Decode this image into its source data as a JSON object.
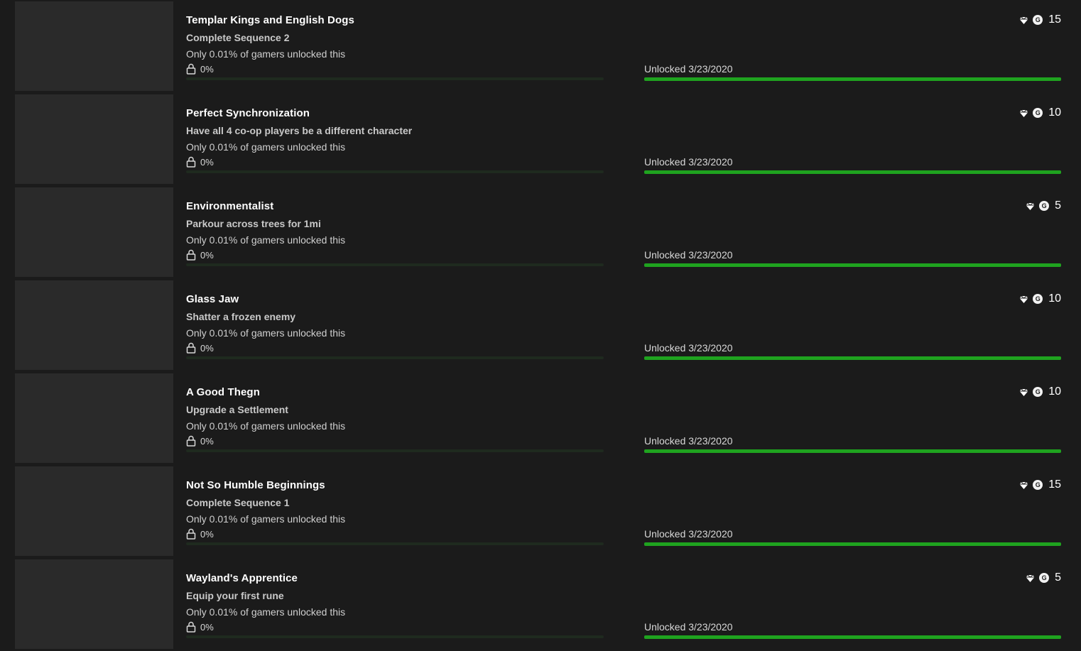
{
  "colors": {
    "background": "#1b1b1b",
    "progress_green": "#1fa31f",
    "thumbnail": "#2a2a2a"
  },
  "achievements": [
    {
      "title": "Templar Kings and English Dogs",
      "description": "Complete Sequence 2",
      "rarity": "Only 0.01% of gamers unlocked this",
      "progress_label": "0%",
      "unlocked": "Unlocked 3/23/2020",
      "score": "15",
      "unlock_progress": 1.0
    },
    {
      "title": "Perfect Synchronization",
      "description": "Have all 4 co-op players be a different character",
      "rarity": "Only 0.01% of gamers unlocked this",
      "progress_label": "0%",
      "unlocked": "Unlocked 3/23/2020",
      "score": "10",
      "unlock_progress": 1.0
    },
    {
      "title": "Environmentalist",
      "description": "Parkour across trees for 1mi",
      "rarity": "Only 0.01% of gamers unlocked this",
      "progress_label": "0%",
      "unlocked": "Unlocked 3/23/2020",
      "score": "5",
      "unlock_progress": 1.0
    },
    {
      "title": "Glass Jaw",
      "description": "Shatter a frozen enemy",
      "rarity": "Only 0.01% of gamers unlocked this",
      "progress_label": "0%",
      "unlocked": "Unlocked 3/23/2020",
      "score": "10",
      "unlock_progress": 1.0
    },
    {
      "title": "A Good Thegn",
      "description": "Upgrade a Settlement",
      "rarity": "Only 0.01% of gamers unlocked this",
      "progress_label": "0%",
      "unlocked": "Unlocked 3/23/2020",
      "score": "10",
      "unlock_progress": 1.0
    },
    {
      "title": "Not So Humble Beginnings",
      "description": "Complete Sequence 1",
      "rarity": "Only 0.01% of gamers unlocked this",
      "progress_label": "0%",
      "unlocked": "Unlocked 3/23/2020",
      "score": "15",
      "unlock_progress": 1.0
    },
    {
      "title": "Wayland's Apprentice",
      "description": "Equip your first rune",
      "rarity": "Only 0.01% of gamers unlocked this",
      "progress_label": "0%",
      "unlocked": "Unlocked 3/23/2020",
      "score": "5",
      "unlock_progress": 1.0
    }
  ],
  "icons": {
    "lock": "lock-icon",
    "gem": "gem-icon",
    "gamerscore": "gamerscore-icon"
  },
  "gamerscore_glyph": "G"
}
